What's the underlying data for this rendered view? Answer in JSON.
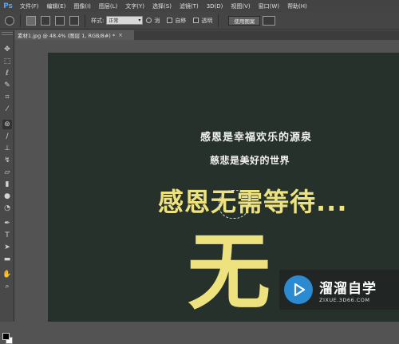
{
  "app": {
    "logo_text": "Ps"
  },
  "menu": {
    "items": [
      "文件(F)",
      "编辑(E)",
      "图像(I)",
      "图层(L)",
      "文字(Y)",
      "选择(S)",
      "滤镜(T)",
      "3D(D)",
      "视图(V)",
      "窗口(W)",
      "帮助(H)"
    ]
  },
  "options": {
    "feather_label": "样式:",
    "style_value": "正常",
    "antialias_label": "消",
    "autoadd_label": "自移",
    "transparent_label": "透明",
    "apply_button_label": "使用图案"
  },
  "document_tab": {
    "title": "素材1.jpg @ 48.4% (图层 1, RGB/8#) *",
    "close_glyph": "×"
  },
  "canvas": {
    "line1": "感恩是幸福欢乐的源泉",
    "line2": "慈悲是美好的世界",
    "line3": "感恩无需等待...",
    "big_char": "无",
    "background_color": "#26312b",
    "headline_color": "#eee27e"
  },
  "watermark": {
    "title": "溜溜自学",
    "url": "ZIXUE.3D66.COM"
  },
  "tools": [
    "move-icon",
    "marquee-icon",
    "lasso-icon",
    "quick-select-icon",
    "crop-icon",
    "eyedropper-icon",
    "healing-icon",
    "brush-icon",
    "stamp-icon",
    "history-brush-icon",
    "eraser-icon",
    "gradient-icon",
    "blur-icon",
    "dodge-icon",
    "pen-icon",
    "type-icon",
    "path-select-icon",
    "shape-icon",
    "hand-icon",
    "zoom-icon"
  ]
}
